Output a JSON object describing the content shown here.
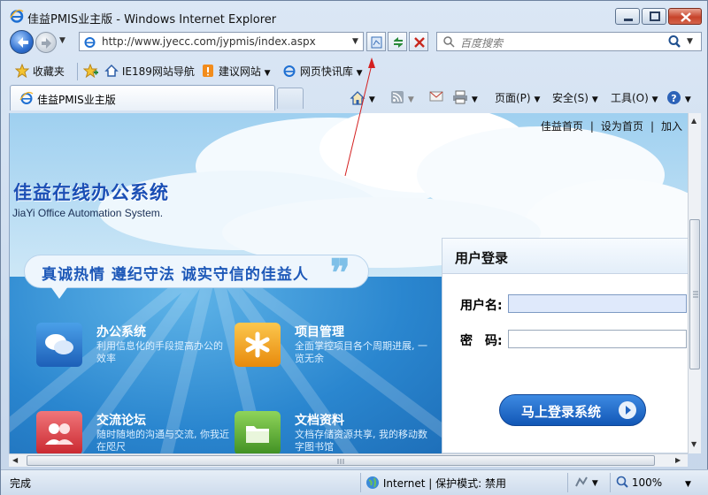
{
  "window": {
    "title": "佳益PMIS业主版 - Windows Internet Explorer"
  },
  "address_bar": {
    "url": "http://www.jyecc.com/jypmis/index.aspx",
    "search_placeholder": "百度搜索"
  },
  "favorites_bar": {
    "favorites_label": "收藏夹",
    "items": [
      "IE189网站导航",
      "建议网站",
      "网页快讯库"
    ]
  },
  "tabs": {
    "active_tab_label": "佳益PMIS业主版"
  },
  "command_bar": {
    "page_label": "页面(P)",
    "safety_label": "安全(S)",
    "tools_label": "工具(O)"
  },
  "page": {
    "top_links": [
      "佳益首页",
      "|",
      "设为首页",
      "|",
      "加入"
    ],
    "site_title": "佳益在线办公系统",
    "site_subtitle": "JiaYi Office Automation System.",
    "slogan": "真诚热情 遵纪守法 诚实守信的佳益人",
    "features": [
      {
        "title": "办公系统",
        "desc": "利用信息化的手段提高办公的效率"
      },
      {
        "title": "项目管理",
        "desc": "全面掌控项目各个周期进展, 一览无余"
      },
      {
        "title": "交流论坛",
        "desc": "随时随地的沟通与交流, 你我近在咫尺"
      },
      {
        "title": "文档资料",
        "desc": "文档存储资源共享, 我的移动数字图书馆"
      }
    ],
    "login": {
      "title": "用户登录",
      "username_label": "用户名:",
      "password_label": "密　码:",
      "username_value": "",
      "password_value": "",
      "submit_label": "马上登录系统"
    }
  },
  "status_bar": {
    "status": "完成",
    "zone": "Internet | 保护模式: 禁用",
    "zoom": "100%"
  },
  "colors": {
    "brand_blue": "#1b4fb5",
    "login_button": "#1257b6",
    "annotation_arrow": "#d42020"
  }
}
